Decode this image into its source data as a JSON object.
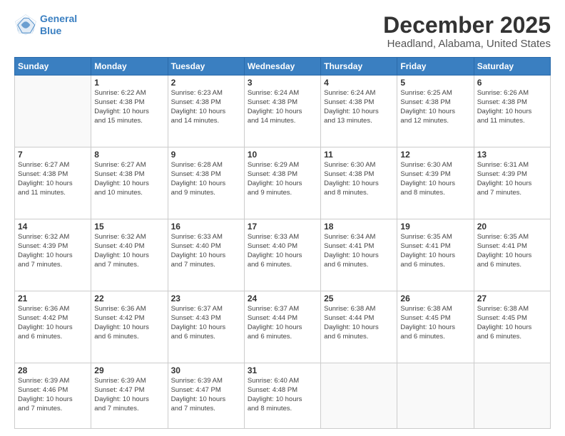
{
  "logo": {
    "line1": "General",
    "line2": "Blue"
  },
  "title": "December 2025",
  "subtitle": "Headland, Alabama, United States",
  "days_header": [
    "Sunday",
    "Monday",
    "Tuesday",
    "Wednesday",
    "Thursday",
    "Friday",
    "Saturday"
  ],
  "weeks": [
    [
      {
        "num": "",
        "info": ""
      },
      {
        "num": "1",
        "info": "Sunrise: 6:22 AM\nSunset: 4:38 PM\nDaylight: 10 hours\nand 15 minutes."
      },
      {
        "num": "2",
        "info": "Sunrise: 6:23 AM\nSunset: 4:38 PM\nDaylight: 10 hours\nand 14 minutes."
      },
      {
        "num": "3",
        "info": "Sunrise: 6:24 AM\nSunset: 4:38 PM\nDaylight: 10 hours\nand 14 minutes."
      },
      {
        "num": "4",
        "info": "Sunrise: 6:24 AM\nSunset: 4:38 PM\nDaylight: 10 hours\nand 13 minutes."
      },
      {
        "num": "5",
        "info": "Sunrise: 6:25 AM\nSunset: 4:38 PM\nDaylight: 10 hours\nand 12 minutes."
      },
      {
        "num": "6",
        "info": "Sunrise: 6:26 AM\nSunset: 4:38 PM\nDaylight: 10 hours\nand 11 minutes."
      }
    ],
    [
      {
        "num": "7",
        "info": "Sunrise: 6:27 AM\nSunset: 4:38 PM\nDaylight: 10 hours\nand 11 minutes."
      },
      {
        "num": "8",
        "info": "Sunrise: 6:27 AM\nSunset: 4:38 PM\nDaylight: 10 hours\nand 10 minutes."
      },
      {
        "num": "9",
        "info": "Sunrise: 6:28 AM\nSunset: 4:38 PM\nDaylight: 10 hours\nand 9 minutes."
      },
      {
        "num": "10",
        "info": "Sunrise: 6:29 AM\nSunset: 4:38 PM\nDaylight: 10 hours\nand 9 minutes."
      },
      {
        "num": "11",
        "info": "Sunrise: 6:30 AM\nSunset: 4:38 PM\nDaylight: 10 hours\nand 8 minutes."
      },
      {
        "num": "12",
        "info": "Sunrise: 6:30 AM\nSunset: 4:39 PM\nDaylight: 10 hours\nand 8 minutes."
      },
      {
        "num": "13",
        "info": "Sunrise: 6:31 AM\nSunset: 4:39 PM\nDaylight: 10 hours\nand 7 minutes."
      }
    ],
    [
      {
        "num": "14",
        "info": "Sunrise: 6:32 AM\nSunset: 4:39 PM\nDaylight: 10 hours\nand 7 minutes."
      },
      {
        "num": "15",
        "info": "Sunrise: 6:32 AM\nSunset: 4:40 PM\nDaylight: 10 hours\nand 7 minutes."
      },
      {
        "num": "16",
        "info": "Sunrise: 6:33 AM\nSunset: 4:40 PM\nDaylight: 10 hours\nand 7 minutes."
      },
      {
        "num": "17",
        "info": "Sunrise: 6:33 AM\nSunset: 4:40 PM\nDaylight: 10 hours\nand 6 minutes."
      },
      {
        "num": "18",
        "info": "Sunrise: 6:34 AM\nSunset: 4:41 PM\nDaylight: 10 hours\nand 6 minutes."
      },
      {
        "num": "19",
        "info": "Sunrise: 6:35 AM\nSunset: 4:41 PM\nDaylight: 10 hours\nand 6 minutes."
      },
      {
        "num": "20",
        "info": "Sunrise: 6:35 AM\nSunset: 4:41 PM\nDaylight: 10 hours\nand 6 minutes."
      }
    ],
    [
      {
        "num": "21",
        "info": "Sunrise: 6:36 AM\nSunset: 4:42 PM\nDaylight: 10 hours\nand 6 minutes."
      },
      {
        "num": "22",
        "info": "Sunrise: 6:36 AM\nSunset: 4:42 PM\nDaylight: 10 hours\nand 6 minutes."
      },
      {
        "num": "23",
        "info": "Sunrise: 6:37 AM\nSunset: 4:43 PM\nDaylight: 10 hours\nand 6 minutes."
      },
      {
        "num": "24",
        "info": "Sunrise: 6:37 AM\nSunset: 4:44 PM\nDaylight: 10 hours\nand 6 minutes."
      },
      {
        "num": "25",
        "info": "Sunrise: 6:38 AM\nSunset: 4:44 PM\nDaylight: 10 hours\nand 6 minutes."
      },
      {
        "num": "26",
        "info": "Sunrise: 6:38 AM\nSunset: 4:45 PM\nDaylight: 10 hours\nand 6 minutes."
      },
      {
        "num": "27",
        "info": "Sunrise: 6:38 AM\nSunset: 4:45 PM\nDaylight: 10 hours\nand 6 minutes."
      }
    ],
    [
      {
        "num": "28",
        "info": "Sunrise: 6:39 AM\nSunset: 4:46 PM\nDaylight: 10 hours\nand 7 minutes."
      },
      {
        "num": "29",
        "info": "Sunrise: 6:39 AM\nSunset: 4:47 PM\nDaylight: 10 hours\nand 7 minutes."
      },
      {
        "num": "30",
        "info": "Sunrise: 6:39 AM\nSunset: 4:47 PM\nDaylight: 10 hours\nand 7 minutes."
      },
      {
        "num": "31",
        "info": "Sunrise: 6:40 AM\nSunset: 4:48 PM\nDaylight: 10 hours\nand 8 minutes."
      },
      {
        "num": "",
        "info": ""
      },
      {
        "num": "",
        "info": ""
      },
      {
        "num": "",
        "info": ""
      }
    ]
  ]
}
